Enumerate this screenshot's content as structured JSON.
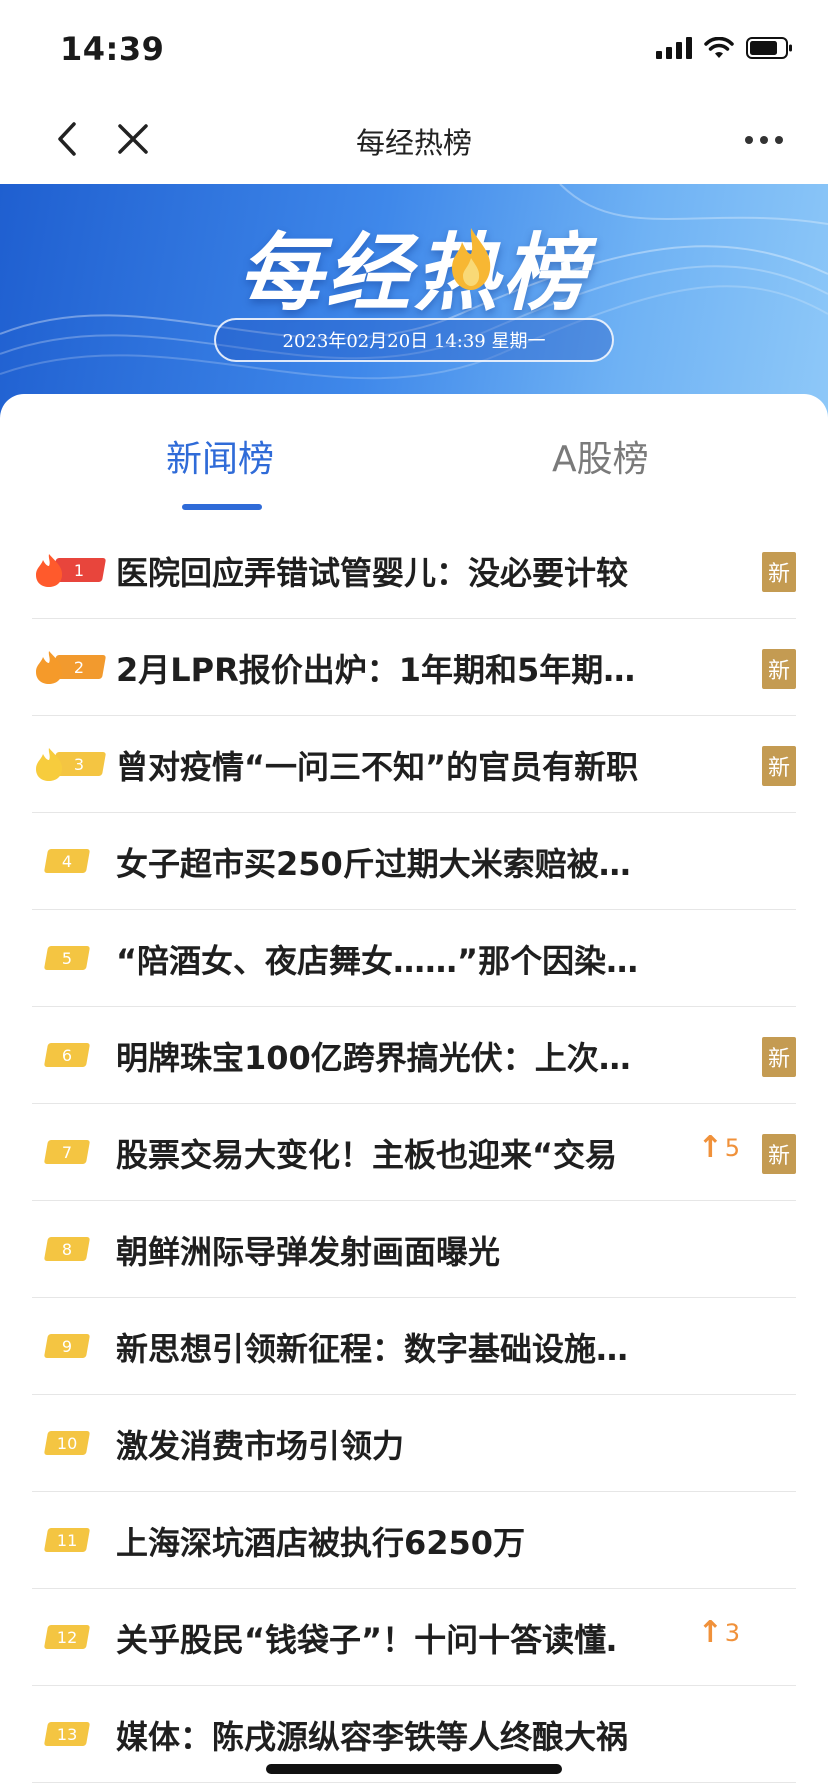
{
  "status": {
    "time": "14:39"
  },
  "nav": {
    "title": "每经热榜"
  },
  "banner": {
    "title": "每经热榜",
    "date": "2023年02月20日 14:39 星期一"
  },
  "tabs": [
    {
      "label": "新闻榜",
      "active": true
    },
    {
      "label": "A股榜",
      "active": false
    }
  ],
  "colors": {
    "accent": "#2f6bd8",
    "rank1": "#e8453c",
    "rank2": "#f29a2e",
    "rank3": "#f4c542",
    "rankOther": "#f4c542",
    "newBadge": "#c49b52",
    "rise": "#f0913a"
  },
  "list": [
    {
      "rank": "1",
      "title": "医院回应弄错试管婴儿：没必要计较",
      "new": "新"
    },
    {
      "rank": "2",
      "title": "2月LPR报价出炉：1年期和5年期…",
      "new": "新"
    },
    {
      "rank": "3",
      "title": "曾对疫情“一问三不知”的官员有新职",
      "new": "新"
    },
    {
      "rank": "4",
      "title": "女子超市买250斤过期大米索赔被…"
    },
    {
      "rank": "5",
      "title": "“陪酒女、夜店舞女……”那个因染…"
    },
    {
      "rank": "6",
      "title": "明牌珠宝100亿跨界搞光伏：上次…",
      "new": "新"
    },
    {
      "rank": "7",
      "title": "股票交易大变化！主板也迎来“交易…",
      "rise": "5",
      "new": "新"
    },
    {
      "rank": "8",
      "title": "朝鲜洲际导弹发射画面曝光"
    },
    {
      "rank": "9",
      "title": "新思想引领新征程：数字基础设施…"
    },
    {
      "rank": "10",
      "title": "激发消费市场引领力"
    },
    {
      "rank": "11",
      "title": "上海深坑酒店被执行6250万"
    },
    {
      "rank": "12",
      "title": "关乎股民“钱袋子”！十问十答读懂…",
      "rise": "3"
    },
    {
      "rank": "13",
      "title": "媒体：陈戌源纵容李铁等人终酿大祸"
    }
  ]
}
